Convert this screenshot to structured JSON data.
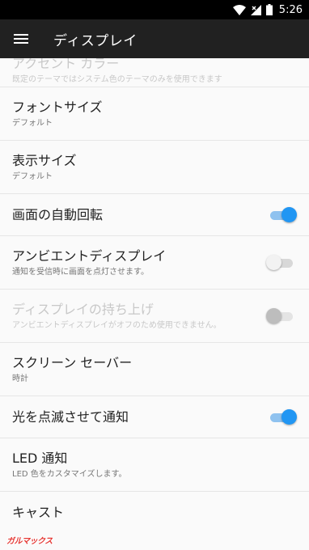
{
  "status_bar": {
    "time": "5:26",
    "icons": [
      "wifi-icon",
      "cell-signal-icon",
      "battery-icon"
    ]
  },
  "toolbar": {
    "menu_icon": "hamburger-menu-icon",
    "title": "ディスプレイ"
  },
  "settings": [
    {
      "label": "アクセント カラー",
      "sub": "既定のテーマではシステム色のテーマのみを使用できます",
      "disabled": true,
      "toggle": null
    },
    {
      "label": "フォントサイズ",
      "sub": "デフォルト",
      "disabled": false,
      "toggle": null
    },
    {
      "label": "表示サイズ",
      "sub": "デフォルト",
      "disabled": false,
      "toggle": null
    },
    {
      "label": "画面の自動回転",
      "sub": "",
      "disabled": false,
      "toggle": "on"
    },
    {
      "label": "アンビエントディスプレイ",
      "sub": "通知を受信時に画面を点灯させます。",
      "disabled": false,
      "toggle": "off"
    },
    {
      "label": "ディスプレイの持ち上げ",
      "sub": "アンビエントディスプレイがオフのため使用できません。",
      "disabled": true,
      "toggle": "disabled"
    },
    {
      "label": "スクリーン セーバー",
      "sub": "時計",
      "disabled": false,
      "toggle": null
    },
    {
      "label": "光を点滅させて通知",
      "sub": "",
      "disabled": false,
      "toggle": "on"
    },
    {
      "label": "LED 通知",
      "sub": "LED 色をカスタマイズします。",
      "disabled": false,
      "toggle": null
    },
    {
      "label": "キャスト",
      "sub": "",
      "disabled": false,
      "toggle": null
    }
  ],
  "watermark": "ガルマックス",
  "colors": {
    "accent": "#2196f3",
    "toolbar": "#212121",
    "status_bar": "#000000",
    "background": "#fafafa"
  }
}
